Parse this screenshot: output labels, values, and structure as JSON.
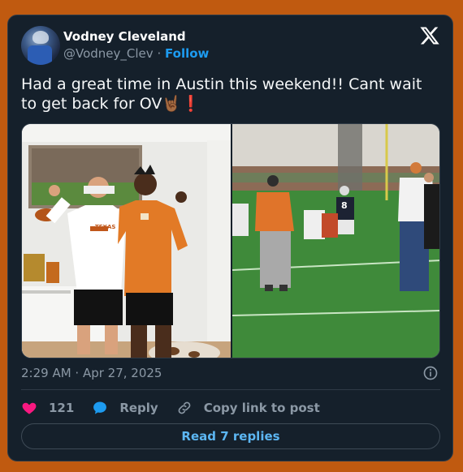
{
  "author": {
    "name": "Vodney Cleveland",
    "handle": "@Vodney_Clev",
    "separator": "·",
    "follow_label": "Follow"
  },
  "tweet": {
    "text": "Had a great time in Austin this weekend!! Cant wait to get back for OV🤘🏾❗",
    "timestamp": "2:29 AM · Apr 27, 2025"
  },
  "media": {
    "left_photo_jersey_text": "TEXAS",
    "right_photo_jersey_number": "8"
  },
  "actions": {
    "like_count": "121",
    "reply_label": "Reply",
    "copy_link_label": "Copy link to post"
  },
  "read_replies_label": "Read 7 replies",
  "colors": {
    "page_background": "#c05a10",
    "card_background": "#15202b",
    "accent": "#1d9bf0",
    "like": "#f91880"
  },
  "icons": [
    "x-logo-icon",
    "info-icon",
    "heart-icon",
    "reply-bubble-icon",
    "link-icon"
  ]
}
